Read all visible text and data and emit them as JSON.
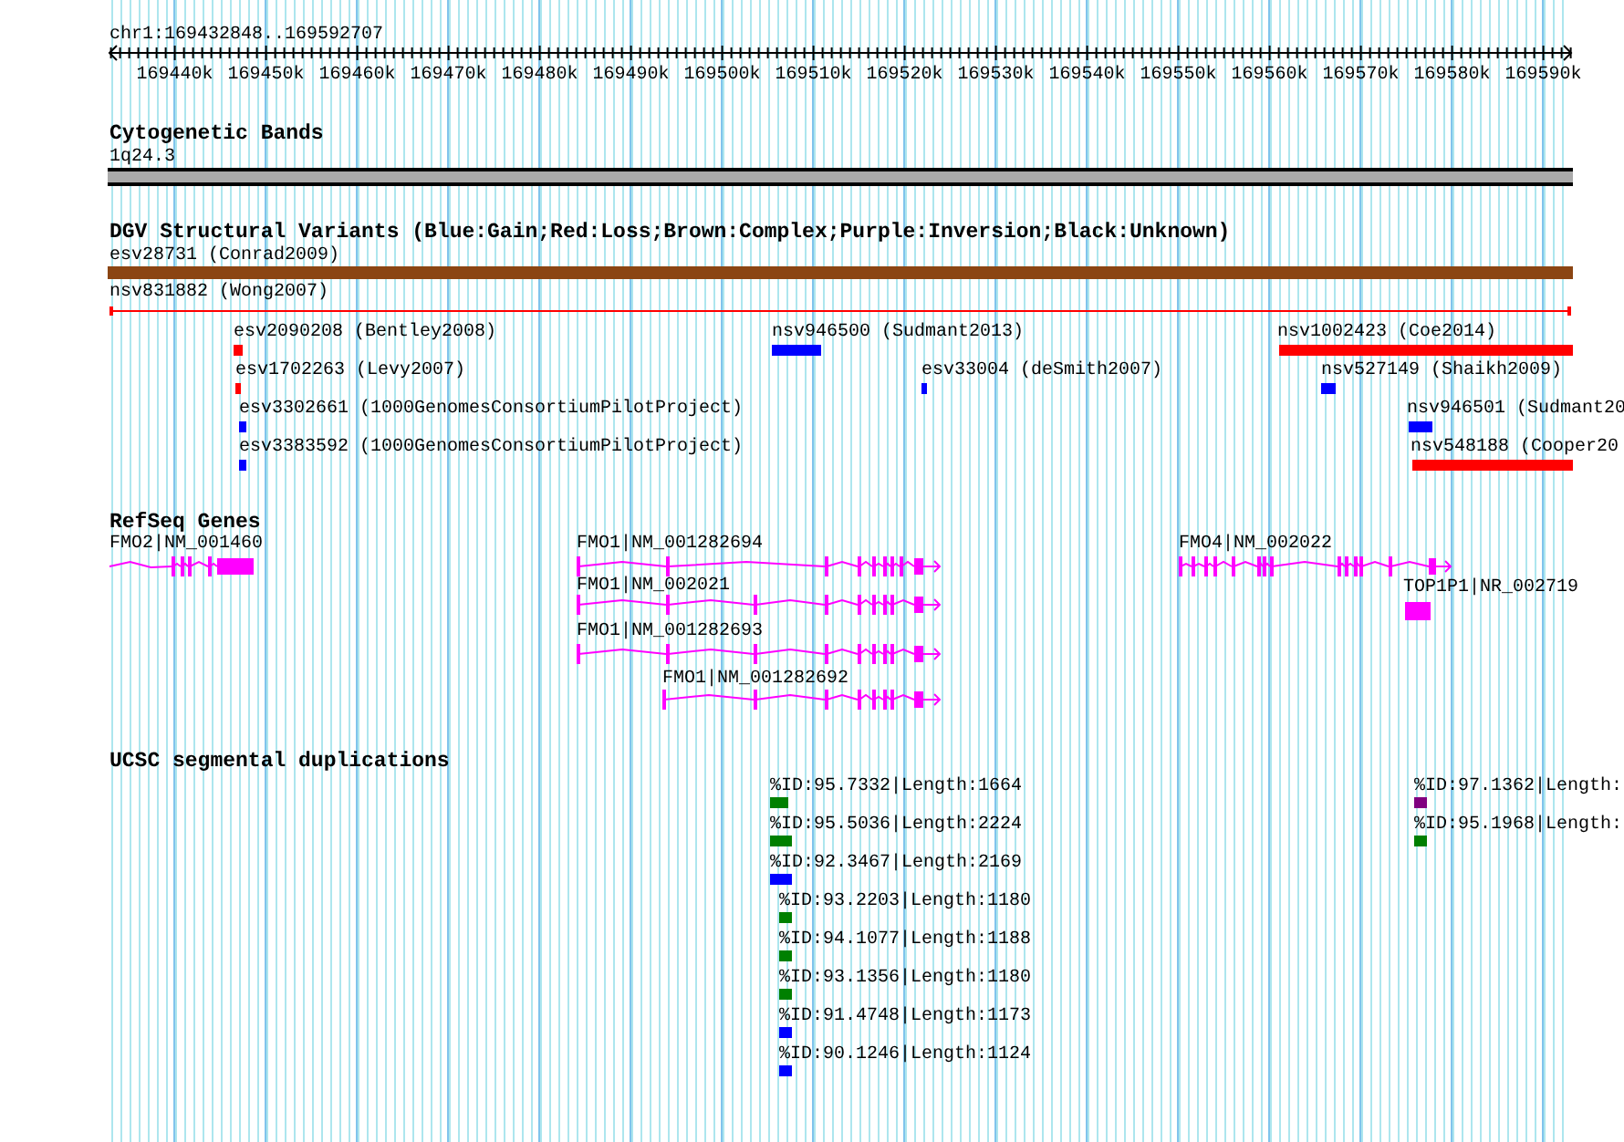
{
  "ruler": {
    "position": "chr1:169432848..169592707",
    "ticks": [
      "169440k",
      "169450k",
      "169460k",
      "169470k",
      "169480k",
      "169490k",
      "169500k",
      "169510k",
      "169520k",
      "169530k",
      "169540k",
      "169550k",
      "169560k",
      "169570k",
      "169580k",
      "169590k"
    ]
  },
  "cytogenetic_bands": {
    "title": "Cytogenetic Bands",
    "band": "1q24.3"
  },
  "dgv": {
    "title": "DGV Structural Variants (Blue:Gain;Red:Loss;Brown:Complex;Purple:Inversion;Black:Unknown)",
    "features": [
      {
        "label": "esv28731 (Conrad2009)",
        "kind": "bar",
        "color": "#8b4513"
      },
      {
        "label": "nsv831882 (Wong2007)",
        "kind": "line",
        "color": "#ff0000"
      },
      {
        "label": "esv2090208 (Bentley2008)",
        "kind": "bar",
        "color": "#ff0000"
      },
      {
        "label": "nsv946500 (Sudmant2013)",
        "kind": "bar",
        "color": "#0000ff"
      },
      {
        "label": "nsv1002423 (Coe2014)",
        "kind": "bar",
        "color": "#ff0000"
      },
      {
        "label": "esv1702263 (Levy2007)",
        "kind": "bar",
        "color": "#ff0000"
      },
      {
        "label": "esv33004 (deSmith2007)",
        "kind": "bar",
        "color": "#0000ff"
      },
      {
        "label": "nsv527149 (Shaikh2009)",
        "kind": "bar",
        "color": "#0000ff"
      },
      {
        "label": "esv3302661 (1000GenomesConsortiumPilotProject)",
        "kind": "bar",
        "color": "#0000ff"
      },
      {
        "label": "nsv946501 (Sudmant20",
        "kind": "bar",
        "color": "#0000ff"
      },
      {
        "label": "esv3383592 (1000GenomesConsortiumPilotProject)",
        "kind": "bar",
        "color": "#0000ff"
      },
      {
        "label": "nsv548188 (Cooper20",
        "kind": "bar",
        "color": "#ff0000"
      }
    ]
  },
  "refseq": {
    "title": "RefSeq Genes",
    "genes": [
      {
        "label": "FMO2|NM_001460",
        "kind": "gene"
      },
      {
        "label": "FMO1|NM_001282694",
        "kind": "gene"
      },
      {
        "label": "FMO4|NM_002022",
        "kind": "gene"
      },
      {
        "label": "FMO1|NM_002021",
        "kind": "gene"
      },
      {
        "label": "TOP1P1|NR_002719",
        "kind": "block"
      },
      {
        "label": "FMO1|NM_001282693",
        "kind": "gene"
      },
      {
        "label": "FMO1|NM_001282692",
        "kind": "gene"
      }
    ]
  },
  "segdups": {
    "title": "UCSC segmental duplications",
    "features": [
      {
        "label": "%ID:95.7332|Length:1664",
        "color": "#008000"
      },
      {
        "label": "%ID:97.1362|Length:",
        "color": "#800080"
      },
      {
        "label": "%ID:95.5036|Length:2224",
        "color": "#008000"
      },
      {
        "label": "%ID:95.1968|Length:",
        "color": "#008000"
      },
      {
        "label": "%ID:92.3467|Length:2169",
        "color": "#0000ff"
      },
      {
        "label": "%ID:93.2203|Length:1180",
        "color": "#008000"
      },
      {
        "label": "%ID:94.1077|Length:1188",
        "color": "#008000"
      },
      {
        "label": "%ID:93.1356|Length:1180",
        "color": "#008000"
      },
      {
        "label": "%ID:91.4748|Length:1173",
        "color": "#0000ff"
      },
      {
        "label": "%ID:90.1246|Length:1124",
        "color": "#0000ff"
      }
    ]
  }
}
